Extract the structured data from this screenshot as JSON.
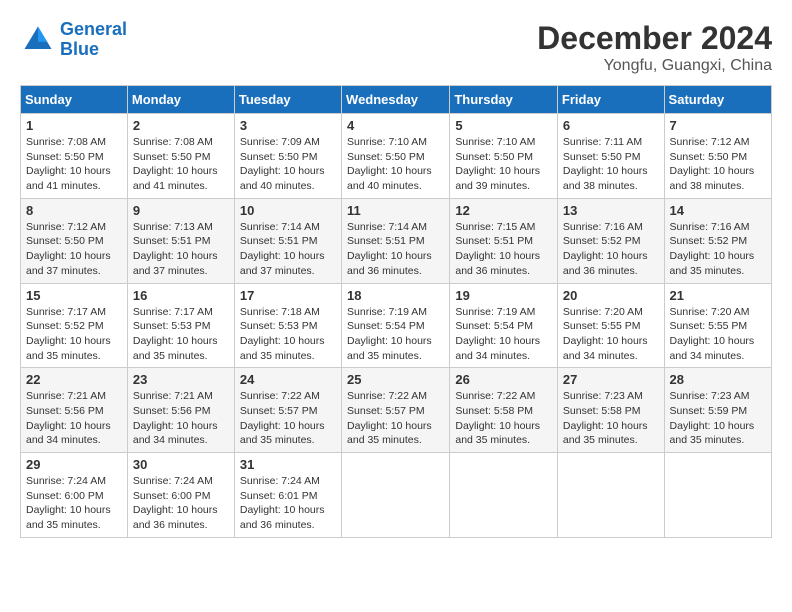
{
  "header": {
    "logo_line1": "General",
    "logo_line2": "Blue",
    "month": "December 2024",
    "location": "Yongfu, Guangxi, China"
  },
  "weekdays": [
    "Sunday",
    "Monday",
    "Tuesday",
    "Wednesday",
    "Thursday",
    "Friday",
    "Saturday"
  ],
  "weeks": [
    [
      {
        "day": "1",
        "sunrise": "7:08 AM",
        "sunset": "5:50 PM",
        "daylight": "10 hours and 41 minutes."
      },
      {
        "day": "2",
        "sunrise": "7:08 AM",
        "sunset": "5:50 PM",
        "daylight": "10 hours and 41 minutes."
      },
      {
        "day": "3",
        "sunrise": "7:09 AM",
        "sunset": "5:50 PM",
        "daylight": "10 hours and 40 minutes."
      },
      {
        "day": "4",
        "sunrise": "7:10 AM",
        "sunset": "5:50 PM",
        "daylight": "10 hours and 40 minutes."
      },
      {
        "day": "5",
        "sunrise": "7:10 AM",
        "sunset": "5:50 PM",
        "daylight": "10 hours and 39 minutes."
      },
      {
        "day": "6",
        "sunrise": "7:11 AM",
        "sunset": "5:50 PM",
        "daylight": "10 hours and 38 minutes."
      },
      {
        "day": "7",
        "sunrise": "7:12 AM",
        "sunset": "5:50 PM",
        "daylight": "10 hours and 38 minutes."
      }
    ],
    [
      {
        "day": "8",
        "sunrise": "7:12 AM",
        "sunset": "5:50 PM",
        "daylight": "10 hours and 37 minutes."
      },
      {
        "day": "9",
        "sunrise": "7:13 AM",
        "sunset": "5:51 PM",
        "daylight": "10 hours and 37 minutes."
      },
      {
        "day": "10",
        "sunrise": "7:14 AM",
        "sunset": "5:51 PM",
        "daylight": "10 hours and 37 minutes."
      },
      {
        "day": "11",
        "sunrise": "7:14 AM",
        "sunset": "5:51 PM",
        "daylight": "10 hours and 36 minutes."
      },
      {
        "day": "12",
        "sunrise": "7:15 AM",
        "sunset": "5:51 PM",
        "daylight": "10 hours and 36 minutes."
      },
      {
        "day": "13",
        "sunrise": "7:16 AM",
        "sunset": "5:52 PM",
        "daylight": "10 hours and 36 minutes."
      },
      {
        "day": "14",
        "sunrise": "7:16 AM",
        "sunset": "5:52 PM",
        "daylight": "10 hours and 35 minutes."
      }
    ],
    [
      {
        "day": "15",
        "sunrise": "7:17 AM",
        "sunset": "5:52 PM",
        "daylight": "10 hours and 35 minutes."
      },
      {
        "day": "16",
        "sunrise": "7:17 AM",
        "sunset": "5:53 PM",
        "daylight": "10 hours and 35 minutes."
      },
      {
        "day": "17",
        "sunrise": "7:18 AM",
        "sunset": "5:53 PM",
        "daylight": "10 hours and 35 minutes."
      },
      {
        "day": "18",
        "sunrise": "7:19 AM",
        "sunset": "5:54 PM",
        "daylight": "10 hours and 35 minutes."
      },
      {
        "day": "19",
        "sunrise": "7:19 AM",
        "sunset": "5:54 PM",
        "daylight": "10 hours and 34 minutes."
      },
      {
        "day": "20",
        "sunrise": "7:20 AM",
        "sunset": "5:55 PM",
        "daylight": "10 hours and 34 minutes."
      },
      {
        "day": "21",
        "sunrise": "7:20 AM",
        "sunset": "5:55 PM",
        "daylight": "10 hours and 34 minutes."
      }
    ],
    [
      {
        "day": "22",
        "sunrise": "7:21 AM",
        "sunset": "5:56 PM",
        "daylight": "10 hours and 34 minutes."
      },
      {
        "day": "23",
        "sunrise": "7:21 AM",
        "sunset": "5:56 PM",
        "daylight": "10 hours and 34 minutes."
      },
      {
        "day": "24",
        "sunrise": "7:22 AM",
        "sunset": "5:57 PM",
        "daylight": "10 hours and 35 minutes."
      },
      {
        "day": "25",
        "sunrise": "7:22 AM",
        "sunset": "5:57 PM",
        "daylight": "10 hours and 35 minutes."
      },
      {
        "day": "26",
        "sunrise": "7:22 AM",
        "sunset": "5:58 PM",
        "daylight": "10 hours and 35 minutes."
      },
      {
        "day": "27",
        "sunrise": "7:23 AM",
        "sunset": "5:58 PM",
        "daylight": "10 hours and 35 minutes."
      },
      {
        "day": "28",
        "sunrise": "7:23 AM",
        "sunset": "5:59 PM",
        "daylight": "10 hours and 35 minutes."
      }
    ],
    [
      {
        "day": "29",
        "sunrise": "7:24 AM",
        "sunset": "6:00 PM",
        "daylight": "10 hours and 35 minutes."
      },
      {
        "day": "30",
        "sunrise": "7:24 AM",
        "sunset": "6:00 PM",
        "daylight": "10 hours and 36 minutes."
      },
      {
        "day": "31",
        "sunrise": "7:24 AM",
        "sunset": "6:01 PM",
        "daylight": "10 hours and 36 minutes."
      },
      null,
      null,
      null,
      null
    ]
  ]
}
